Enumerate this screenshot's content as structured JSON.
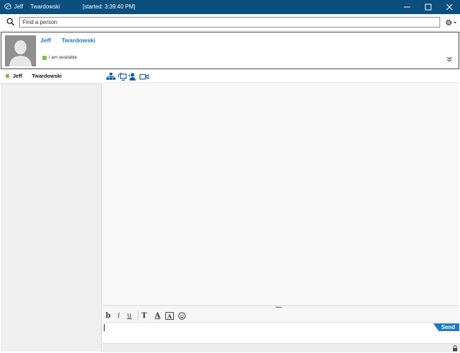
{
  "window": {
    "contact_first": "Jeff",
    "contact_last": "Twardowski",
    "started": "[started: 3:39:40 PM]",
    "app_icon": "chat-bubbles-icon",
    "title_bar_color": "#0b4f7f"
  },
  "search": {
    "placeholder": "Find a person"
  },
  "contact_card": {
    "first_name": "Jeff",
    "last_name": "Twardowski",
    "status": "I am available",
    "name_color": "#1f7ac4",
    "presence_color": "#7cc142"
  },
  "participants": [
    {
      "first_name": "Jeff",
      "last_name": "Twardowski"
    }
  ],
  "conversation_toolbar": {
    "icons": [
      "participants-icon",
      "screen-share-icon",
      "add-person-icon",
      "video-camera-icon"
    ]
  },
  "formatting_toolbar": {
    "bold": "b",
    "italic": "i",
    "underline": "u",
    "font": "T",
    "font_color": "A",
    "highlight": "A",
    "emoticon": "smiley-icon"
  },
  "compose": {
    "send_label": "Send",
    "send_color": "#1f7ac4"
  }
}
